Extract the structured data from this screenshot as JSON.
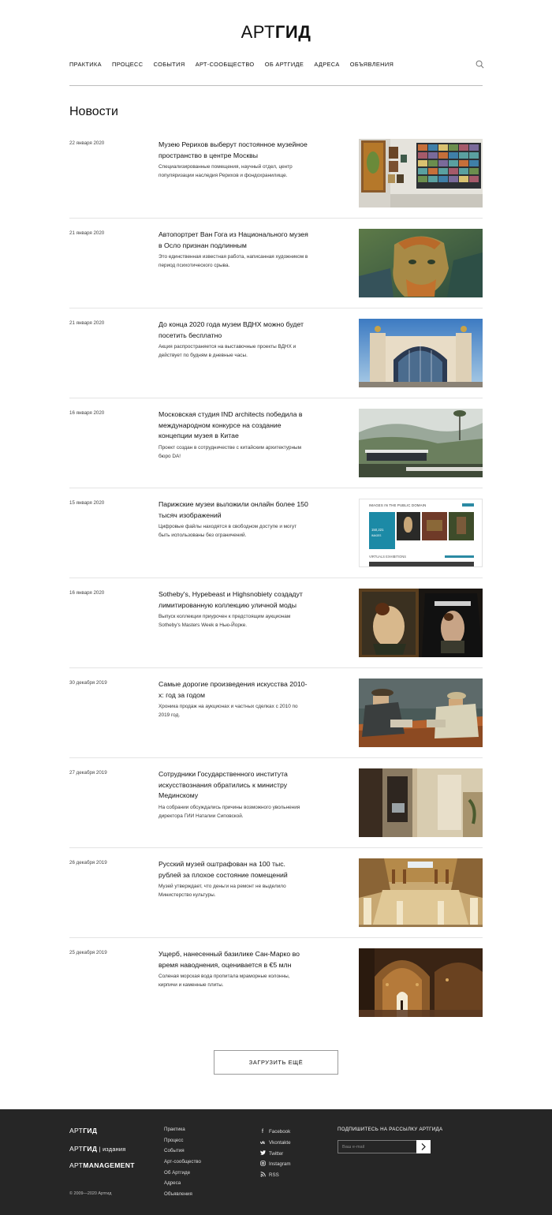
{
  "logo": {
    "light": "АРТ",
    "bold": "ГИД"
  },
  "nav": [
    "Практика",
    "Процесс",
    "События",
    "Арт-сообщество",
    "Об Артгиде",
    "Адреса",
    "Объявления"
  ],
  "page_title": "Новости",
  "news": [
    {
      "date": "22 января 2020",
      "title": "Музею Рерихов выберут постоянное музейное пространство в центре Москвы",
      "desc": "Специализированные помещения, научный отдел, центр популяризации наследия Рерихов и фондохранилище.",
      "image": "gallery-hall-with-paintings"
    },
    {
      "date": "21 января 2020",
      "title": "Автопортрет Ван Гога из Национального музея в Осло признан подлинным",
      "desc": "Это единственная известная работа, написанная художником в период психотического срыва.",
      "image": "van-gogh-self-portrait"
    },
    {
      "date": "21 января 2020",
      "title": "До конца 2020 года музеи ВДНХ можно будет посетить бесплатно",
      "desc": "Акция распространяется на выставочные проекты ВДНХ и действует по будням в дневные часы.",
      "image": "vdnh-pavilion-arch"
    },
    {
      "date": "16 января 2020",
      "title": "Московская студия IND architects победила в международном конкурсе на создание концепции музея в Китае",
      "desc": "Проект создан в сотрудничестве с китайским архитектурным бюро DA!",
      "image": "museum-concept-render"
    },
    {
      "date": "15 января 2020",
      "title": "Парижские музеи выложили онлайн более 150 тысяч изображений",
      "desc": "Цифровые файлы находятся в свободном доступе и могут быть использованы без ограничений.",
      "image": "paris-musees-website",
      "website": {
        "heading": "IMAGES IN THE PUBLIC DOMAIN",
        "count": "150,221",
        "count_label": "IMAGES",
        "section": "VIRTUALS EXHIBITIONS"
      }
    },
    {
      "date": "16 января 2020",
      "title": "Sotheby's, Hypebeast и Highsnobiety создадут лимитированную коллекцию уличной моды",
      "desc": "Выпуск коллекции приурочен к предстоящим аукционам Sotheby's Masters Week в Нью-Йорке.",
      "image": "painting-and-printed-tshirt"
    },
    {
      "date": "30 декабря 2019",
      "title": "Самые дорогие произведения искусства 2010-х: год за годом",
      "desc": "Хроника продаж на аукционах и частных сделках с 2010 по 2019 год.",
      "image": "cezanne-card-players"
    },
    {
      "date": "27 декабря 2019",
      "title": "Сотрудники Государственного института искусствознания обратились к министру Мединскому",
      "desc": "На собрании обсуждались причины возможного увольнения директора ГИИ Наталии Сиповской.",
      "image": "institute-interior"
    },
    {
      "date": "26 декабря 2019",
      "title": "Русский музей оштрафован на 100 тыс. рублей за плохое состояние помещений",
      "desc": "Музей утверждает, что деньги на ремонт не выделило Министерство культуры.",
      "image": "russian-museum-ceiling"
    },
    {
      "date": "25 декабря 2019",
      "title": "Ущерб, нанесенный базилике Сан-Марко во время наводнения, оценивается в €5 млн",
      "desc": "Соленая морская вода пропитала мраморные колонны, кирпичи и каменные плиты.",
      "image": "san-marco-flooded-interior"
    }
  ],
  "load_more": "Загрузить ещё",
  "footer": {
    "brands": [
      {
        "light": "АРТ",
        "bold": "ГИД",
        "suffix": ""
      },
      {
        "light": "АРТ",
        "bold": "ГИД",
        "suffix": " | издания"
      },
      {
        "light": "АРТ",
        "bold": "MANAGEMENT",
        "suffix": ""
      }
    ],
    "copyright": "© 2009—2020 Артгид",
    "links": [
      "Практика",
      "Процесс",
      "События",
      "Арт-сообщество",
      "Об Артгиде",
      "Адреса",
      "Объявления"
    ],
    "social": [
      {
        "label": "Facebook",
        "icon": "facebook-icon"
      },
      {
        "label": "Vkontakte",
        "icon": "vk-icon"
      },
      {
        "label": "Twitter",
        "icon": "twitter-icon"
      },
      {
        "label": "Instagram",
        "icon": "instagram-icon"
      },
      {
        "label": "RSS",
        "icon": "rss-icon"
      }
    ],
    "subscribe_title": "Подпишитесь на рассылку Артгида",
    "email_placeholder": "Ваш e-mail"
  }
}
